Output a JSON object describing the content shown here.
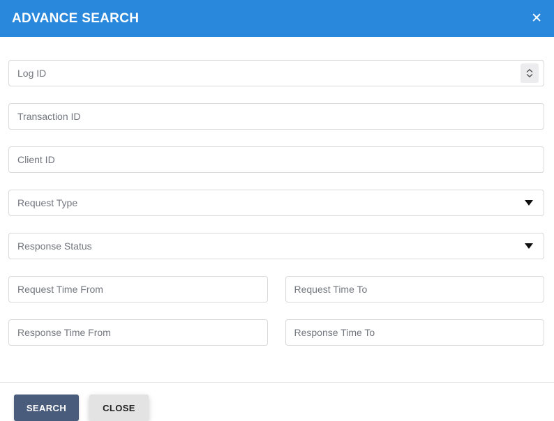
{
  "modal": {
    "title": "ADVANCE SEARCH"
  },
  "icons": {
    "close": "✕",
    "dropdown_caret": "▼",
    "number_spinner": "up-down-chevrons"
  },
  "fields": {
    "log_id": {
      "placeholder": "Log ID",
      "value": "",
      "type": "number"
    },
    "transaction_id": {
      "placeholder": "Transaction ID",
      "value": ""
    },
    "client_id": {
      "placeholder": "Client ID",
      "value": ""
    },
    "request_type": {
      "placeholder": "Request Type",
      "selected": ""
    },
    "response_status": {
      "placeholder": "Response Status",
      "selected": ""
    },
    "request_time_from": {
      "placeholder": "Request Time From",
      "value": ""
    },
    "request_time_to": {
      "placeholder": "Request Time To",
      "value": ""
    },
    "response_time_from": {
      "placeholder": "Response Time From",
      "value": ""
    },
    "response_time_to": {
      "placeholder": "Response Time To",
      "value": ""
    }
  },
  "footer": {
    "search_label": "SEARCH",
    "close_label": "CLOSE"
  },
  "colors": {
    "header_bg": "#2a88dc",
    "search_btn_bg": "#4a5c7c",
    "close_btn_bg": "#e3e3e3",
    "field_border": "#d9d9d9",
    "placeholder": "#72767e"
  }
}
